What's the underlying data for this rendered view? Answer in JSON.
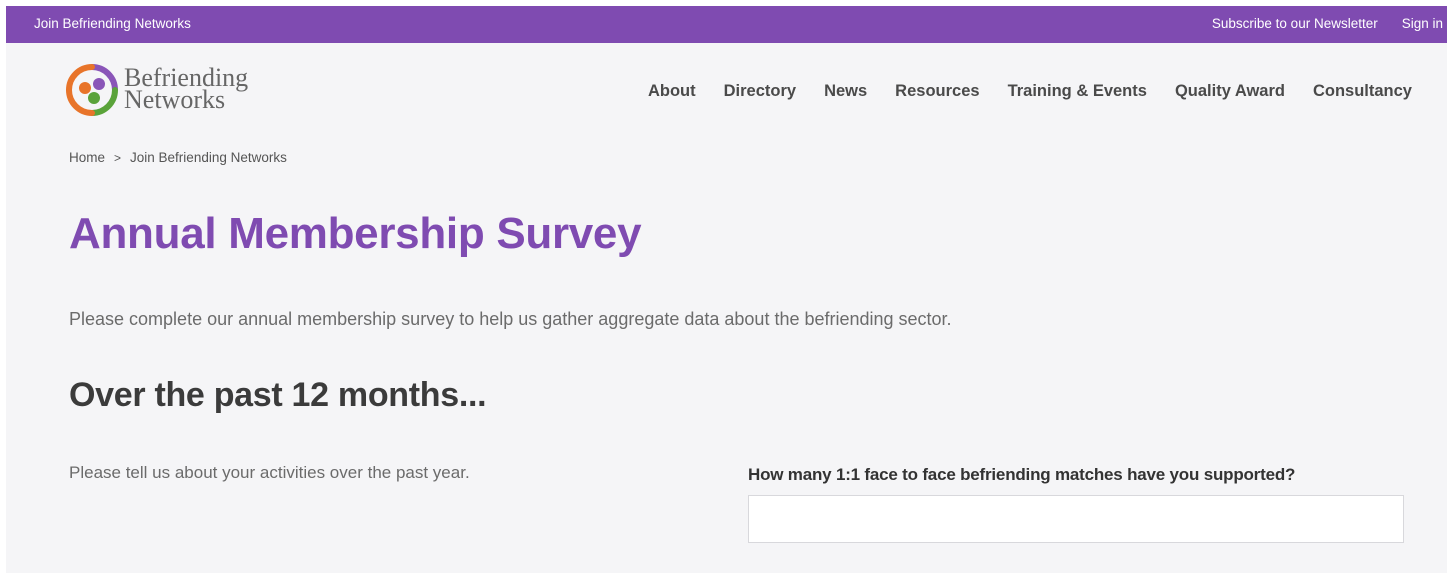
{
  "topbar": {
    "join_label": "Join Befriending Networks",
    "newsletter_label": "Subscribe to our Newsletter",
    "signin_label": "Sign in"
  },
  "logo": {
    "line1": "Befriending",
    "line2": "Networks"
  },
  "nav": {
    "items": [
      "About",
      "Directory",
      "News",
      "Resources",
      "Training & Events",
      "Quality Award",
      "Consultancy"
    ]
  },
  "breadcrumb": {
    "home": "Home",
    "current": "Join Befriending Networks",
    "separator": ">"
  },
  "page": {
    "title": "Annual Membership Survey",
    "intro": "Please complete our annual membership survey to help us gather aggregate data about the befriending sector."
  },
  "section": {
    "title": "Over the past 12 months...",
    "description": "Please tell us about your activities over the past year.",
    "question_label": "How many 1:1 face to face befriending matches have you supported?",
    "question_value": ""
  },
  "colors": {
    "brand_purple": "#7f4bb1",
    "page_background": "#f5f5f7",
    "logo_orange": "#e8742a",
    "logo_green": "#5aa33a",
    "logo_purple": "#8a55b8"
  }
}
